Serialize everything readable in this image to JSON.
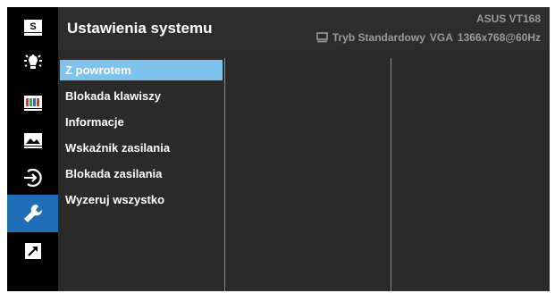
{
  "header": {
    "title": "Ustawienia systemu",
    "model": "ASUS VT168",
    "mode": "Tryb Standardowy",
    "input": "VGA",
    "resolution": "1366x768@60Hz"
  },
  "sidebar": {
    "items": [
      {
        "icon": "splendid-icon",
        "label": "S"
      },
      {
        "icon": "brightness-icon"
      },
      {
        "icon": "color-icon"
      },
      {
        "icon": "image-icon"
      },
      {
        "icon": "input-select-icon"
      },
      {
        "icon": "system-setup-icon",
        "active": true
      },
      {
        "icon": "shortcut-icon"
      }
    ]
  },
  "menu": {
    "items": [
      {
        "label": "Z powrotem",
        "selected": true
      },
      {
        "label": "Blokada klawiszy"
      },
      {
        "label": "Informacje"
      },
      {
        "label": "Wskaźnik zasilania"
      },
      {
        "label": "Blokada zasilania"
      },
      {
        "label": "Wyzeruj wszystko"
      }
    ]
  },
  "colors": {
    "active_sidebar": "#1f6eb5",
    "selected_item": "#7ec3ee",
    "header_bg": "#2d2d2d",
    "content_bg": "#2a2a2a"
  }
}
